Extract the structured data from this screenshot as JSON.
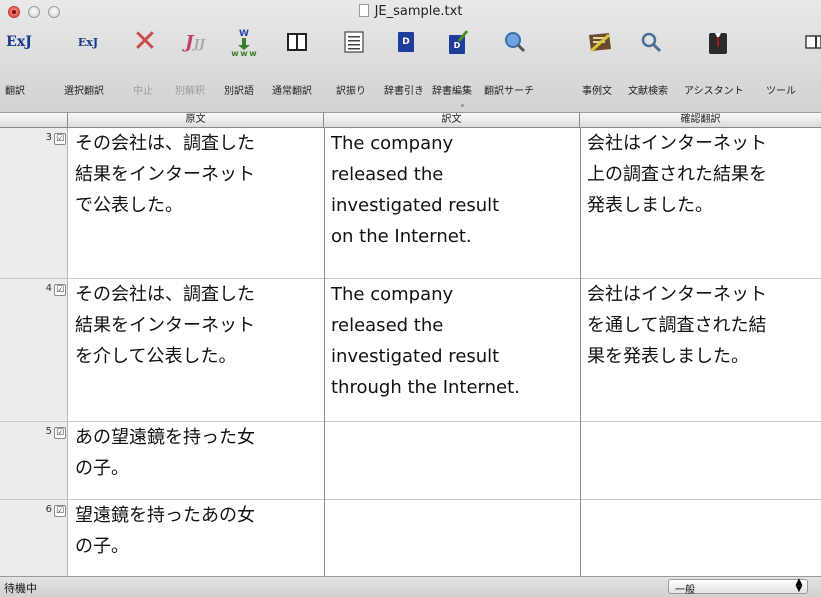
{
  "window": {
    "title": "JE_sample.txt",
    "accent": "#153a8c"
  },
  "toolbar": {
    "items": [
      {
        "label": "翻訳",
        "icon": "exj-translate-icon",
        "disabled": false
      },
      {
        "label": "選択翻訳",
        "icon": "exj-selection-translate-icon",
        "disabled": false
      },
      {
        "label": "中止",
        "icon": "stop-x-icon",
        "disabled": true
      },
      {
        "label": "別解釈",
        "icon": "alternate-interpretation-icon",
        "disabled": true
      },
      {
        "label": "別訳語",
        "icon": "alternate-word-icon",
        "disabled": false
      },
      {
        "label": "通常翻訳",
        "icon": "columns-icon",
        "disabled": false
      },
      {
        "label": "訳振り",
        "icon": "lines-icon",
        "disabled": false
      },
      {
        "label": "辞書引き",
        "icon": "dictionary-icon",
        "disabled": false
      },
      {
        "label": "辞書編集",
        "icon": "dictionary-edit-icon",
        "disabled": false
      },
      {
        "label": "翻訳サーチ",
        "icon": "translation-search-icon",
        "disabled": false
      },
      {
        "label": "事例文",
        "icon": "example-sentence-icon",
        "disabled": false
      },
      {
        "label": "文献検索",
        "icon": "magnifier-icon",
        "disabled": false
      },
      {
        "label": "アシスタント",
        "icon": "assistant-icon",
        "disabled": false
      },
      {
        "label": "ツール",
        "icon": "tool-icon",
        "disabled": false
      }
    ]
  },
  "columns": {
    "source": "原文",
    "translation": "訳文",
    "check": "確認翻訳"
  },
  "rows": [
    {
      "num": "3",
      "checked": "☑",
      "source": "その会社は、調査した\n結果をインターネット\nで公表した。",
      "translation": "The company\nreleased the\ninvestigated result\non the Internet.",
      "check": "会社はインターネット\n上の調査された結果を\n発表しました。"
    },
    {
      "num": "4",
      "checked": "☑",
      "source": "その会社は、調査した\n結果をインターネット\nを介して公表した。",
      "translation": "The company\nreleased the\ninvestigated result\nthrough the Internet.",
      "check": "会社はインターネット\nを通して調査された結\n果を発表しました。"
    },
    {
      "num": "5",
      "checked": "☑",
      "source": "あの望遠鏡を持った女\nの子。",
      "translation": "",
      "check": ""
    },
    {
      "num": "6",
      "checked": "☑",
      "source": "望遠鏡を持ったあの女\nの子。",
      "translation": "",
      "check": ""
    }
  ],
  "status": {
    "text": "待機中",
    "mode": "一般",
    "mode_arrows": "▲▼"
  }
}
